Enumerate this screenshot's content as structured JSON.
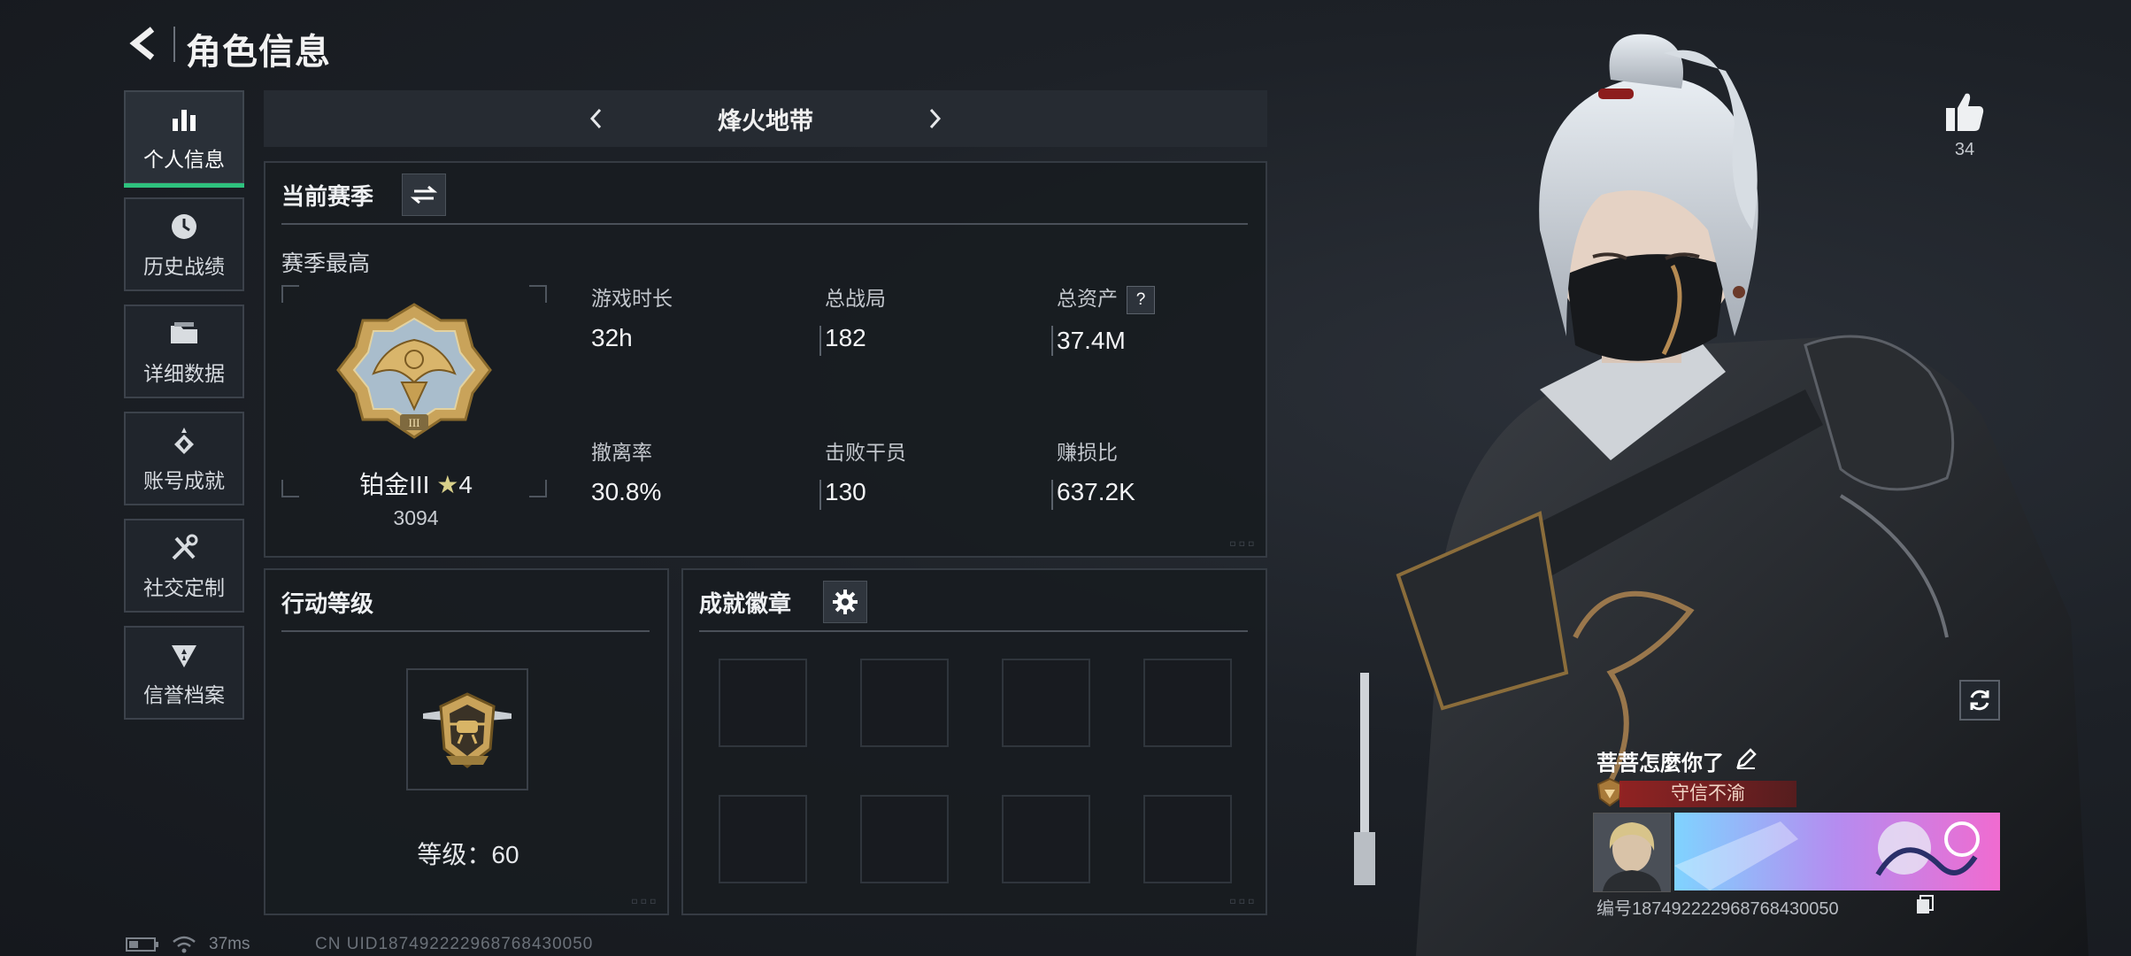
{
  "header": {
    "title": "角色信息"
  },
  "nav": {
    "items": [
      {
        "label": "个人信息",
        "icon": "bar-chart-icon",
        "active": true
      },
      {
        "label": "历史战绩",
        "icon": "clock-icon"
      },
      {
        "label": "详细数据",
        "icon": "folder-icon"
      },
      {
        "label": "账号成就",
        "icon": "achievement-icon"
      },
      {
        "label": "社交定制",
        "icon": "tools-icon"
      },
      {
        "label": "信誉档案",
        "icon": "shield-icon"
      }
    ]
  },
  "mode": {
    "label": "烽火地带"
  },
  "season": {
    "heading": "当前赛季",
    "best_label": "赛季最高",
    "rank_name": "铂金III",
    "rank_stars": "4",
    "rank_score": "3094",
    "stats": [
      {
        "key": "游戏时长",
        "value": "32h"
      },
      {
        "key": "总战局",
        "value": "182"
      },
      {
        "key": "总资产",
        "value": "37.4M",
        "help": "?"
      },
      {
        "key": "撤离率",
        "value": "30.8%"
      },
      {
        "key": "击败干员",
        "value": "130"
      },
      {
        "key": "赚损比",
        "value": "637.2K"
      }
    ]
  },
  "action_level": {
    "heading": "行动等级",
    "level_label": "等级：",
    "level_value": "60"
  },
  "badges": {
    "heading": "成就徽章",
    "slots": 8
  },
  "status_bar": {
    "ping": "37ms",
    "uid": "CN UID187492222968768430050"
  },
  "likes": {
    "count": "34"
  },
  "profile_card": {
    "name": "菩菩怎麼你了",
    "title": "守信不渝",
    "id_text": "编号187492222968768430050"
  },
  "colors": {
    "accent": "#2ec27e",
    "title_banner": "#962222",
    "gold": "#c8a35c"
  }
}
